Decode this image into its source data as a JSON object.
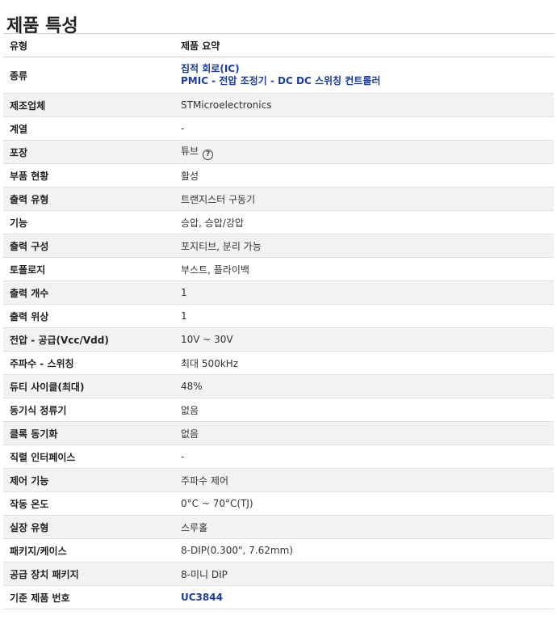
{
  "title": "제품 특성",
  "header": {
    "col1": "유형",
    "col2": "제품 요약"
  },
  "rows": [
    {
      "label": "종류",
      "value": "",
      "links": [
        "집적 회로(IC)",
        "PMIC - 전압 조정기 - DC DC 스위칭 컨트롤러"
      ]
    },
    {
      "label": "제조업체",
      "value": "STMicroelectronics"
    },
    {
      "label": "계열",
      "value": "-"
    },
    {
      "label": "포장",
      "value": "튜브",
      "icon": "help-circle-icon"
    },
    {
      "label": "부품 현황",
      "value": "활성"
    },
    {
      "label": "출력 유형",
      "value": "트랜지스터 구동기"
    },
    {
      "label": "기능",
      "value": "승압, 승압/강압"
    },
    {
      "label": "출력 구성",
      "value": "포지티브, 분리 가능"
    },
    {
      "label": "토폴로지",
      "value": "부스트, 플라이백"
    },
    {
      "label": "출력 개수",
      "value": "1"
    },
    {
      "label": "출력 위상",
      "value": "1"
    },
    {
      "label": "전압 - 공급(Vcc/Vdd)",
      "value": "10V ~ 30V"
    },
    {
      "label": "주파수 - 스위칭",
      "value": "최대 500kHz"
    },
    {
      "label": "듀티 사이클(최대)",
      "value": "48%"
    },
    {
      "label": "동기식 정류기",
      "value": "없음"
    },
    {
      "label": "클록 동기화",
      "value": "없음"
    },
    {
      "label": "직렬 인터페이스",
      "value": "-"
    },
    {
      "label": "제어 기능",
      "value": "주파수 제어"
    },
    {
      "label": "작동 온도",
      "value": "0°C ~ 70°C(TJ)"
    },
    {
      "label": "실장 유형",
      "value": "스루홀"
    },
    {
      "label": "패키지/케이스",
      "value": "8-DIP(0.300\", 7.62mm)"
    },
    {
      "label": "공급 장치 패키지",
      "value": "8-미니 DIP"
    },
    {
      "label": "기준 제품 번호",
      "value": "",
      "links": [
        "UC3844"
      ]
    }
  ]
}
